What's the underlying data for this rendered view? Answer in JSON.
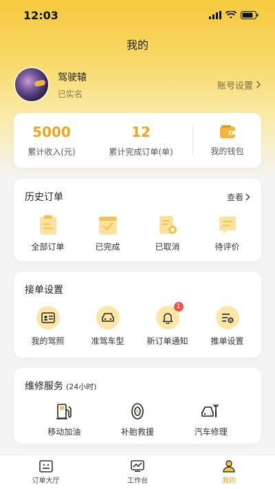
{
  "status_bar": {
    "time": "12:03"
  },
  "header": {
    "title": "我的"
  },
  "profile": {
    "name": "驾驶辕",
    "status": "已实名",
    "account_settings_label": "账号设置"
  },
  "stats": {
    "income_value": "5000",
    "income_label": "累计收入(元)",
    "orders_value": "12",
    "orders_label": "累计完成订单(单)",
    "wallet_label": "我的钱包"
  },
  "history": {
    "title": "历史订单",
    "view_label": "查看",
    "items": [
      {
        "label": "全部订单",
        "icon": "clipboard-icon"
      },
      {
        "label": "已完成",
        "icon": "check-icon"
      },
      {
        "label": "已取消",
        "icon": "cancel-doc-icon"
      },
      {
        "label": "待评价",
        "icon": "comment-icon"
      }
    ]
  },
  "order_settings": {
    "title": "接单设置",
    "items": [
      {
        "label": "我的驾照",
        "icon": "license-icon"
      },
      {
        "label": "准驾车型",
        "icon": "car-icon"
      },
      {
        "label": "新订单通知",
        "icon": "bell-icon",
        "badge": "1"
      },
      {
        "label": "推单设置",
        "icon": "settings-list-icon"
      }
    ]
  },
  "repair": {
    "title": "维修服务",
    "subtitle": "(24小时)",
    "items": [
      {
        "label": "移动加油",
        "icon": "fuel-icon"
      },
      {
        "label": "补胎救援",
        "icon": "tire-icon"
      },
      {
        "label": "汽车修理",
        "icon": "car-repair-icon"
      }
    ]
  },
  "tabbar": {
    "items": [
      {
        "label": "订单大厅",
        "icon": "order-hall-icon"
      },
      {
        "label": "工作台",
        "icon": "workbench-icon"
      },
      {
        "label": "我的",
        "icon": "person-icon",
        "active": true
      }
    ]
  },
  "colors": {
    "accent": "#e9a823",
    "active_tab": "#d8a42b",
    "badge": "#e85646"
  }
}
